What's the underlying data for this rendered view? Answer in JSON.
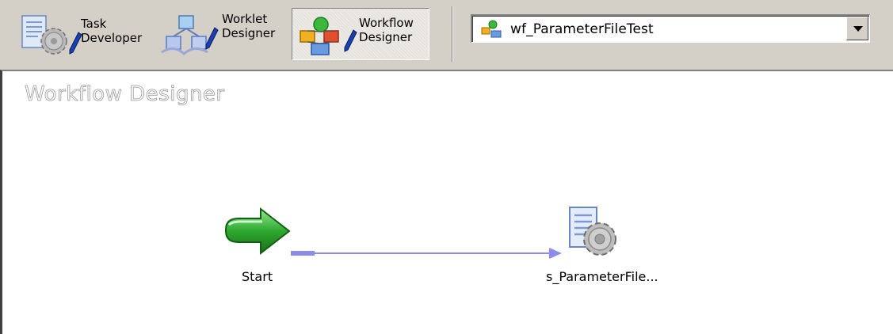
{
  "toolbar": {
    "task_developer": {
      "line1": "Task",
      "line2": "Developer"
    },
    "worklet_designer": {
      "line1": "Worklet",
      "line2": "Designer"
    },
    "workflow_designer": {
      "line1": "Workflow",
      "line2": "Designer",
      "active": true
    }
  },
  "workflow_select": {
    "value": "wf_ParameterFileTest"
  },
  "canvas": {
    "title": "Workflow Designer",
    "nodes": {
      "start": {
        "label": "Start",
        "icon": "start-arrow-icon"
      },
      "session": {
        "label": "s_ParameterFile...",
        "icon": "session-task-icon"
      }
    }
  },
  "colors": {
    "link": "#8c8cf0",
    "start_green": "#2fa82f"
  }
}
